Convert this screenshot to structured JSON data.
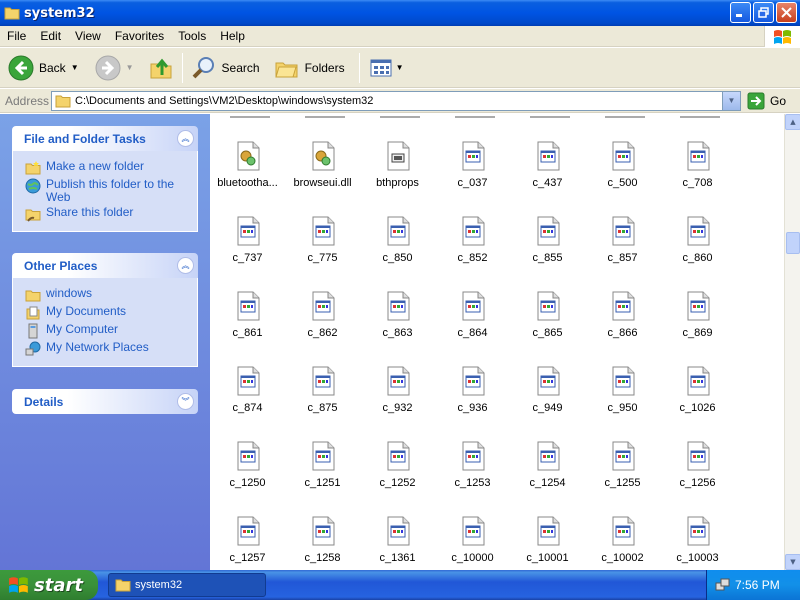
{
  "window": {
    "title": "system32"
  },
  "menu": [
    "File",
    "Edit",
    "View",
    "Favorites",
    "Tools",
    "Help"
  ],
  "toolbar": {
    "back_label": "Back",
    "search_label": "Search",
    "folders_label": "Folders"
  },
  "address": {
    "label": "Address",
    "path": "C:\\Documents and Settings\\VM2\\Desktop\\windows\\system32",
    "go_label": "Go"
  },
  "taskpane": {
    "file_tasks": {
      "title": "File and Folder Tasks",
      "items": [
        {
          "label": "Make a new folder",
          "icon": "new-folder-icon"
        },
        {
          "label": "Publish this folder to the Web",
          "icon": "publish-web-icon"
        },
        {
          "label": "Share this folder",
          "icon": "share-folder-icon"
        }
      ]
    },
    "other_places": {
      "title": "Other Places",
      "items": [
        {
          "label": "windows",
          "icon": "folder-icon"
        },
        {
          "label": "My Documents",
          "icon": "my-documents-icon"
        },
        {
          "label": "My Computer",
          "icon": "my-computer-icon"
        },
        {
          "label": "My Network Places",
          "icon": "network-places-icon"
        }
      ]
    },
    "details": {
      "title": "Details"
    }
  },
  "files": [
    {
      "name": "bluetootha...",
      "type": "dll"
    },
    {
      "name": "browseui.dll",
      "type": "dll"
    },
    {
      "name": "bthprops",
      "type": "cpl"
    },
    {
      "name": "c_037",
      "type": "nls"
    },
    {
      "name": "c_437",
      "type": "nls"
    },
    {
      "name": "c_500",
      "type": "nls"
    },
    {
      "name": "c_708",
      "type": "nls"
    },
    {
      "name": "c_737",
      "type": "nls"
    },
    {
      "name": "c_775",
      "type": "nls"
    },
    {
      "name": "c_850",
      "type": "nls"
    },
    {
      "name": "c_852",
      "type": "nls"
    },
    {
      "name": "c_855",
      "type": "nls"
    },
    {
      "name": "c_857",
      "type": "nls"
    },
    {
      "name": "c_860",
      "type": "nls"
    },
    {
      "name": "c_861",
      "type": "nls"
    },
    {
      "name": "c_862",
      "type": "nls"
    },
    {
      "name": "c_863",
      "type": "nls"
    },
    {
      "name": "c_864",
      "type": "nls"
    },
    {
      "name": "c_865",
      "type": "nls"
    },
    {
      "name": "c_866",
      "type": "nls"
    },
    {
      "name": "c_869",
      "type": "nls"
    },
    {
      "name": "c_874",
      "type": "nls"
    },
    {
      "name": "c_875",
      "type": "nls"
    },
    {
      "name": "c_932",
      "type": "nls"
    },
    {
      "name": "c_936",
      "type": "nls"
    },
    {
      "name": "c_949",
      "type": "nls"
    },
    {
      "name": "c_950",
      "type": "nls"
    },
    {
      "name": "c_1026",
      "type": "nls"
    },
    {
      "name": "c_1250",
      "type": "nls"
    },
    {
      "name": "c_1251",
      "type": "nls"
    },
    {
      "name": "c_1252",
      "type": "nls"
    },
    {
      "name": "c_1253",
      "type": "nls"
    },
    {
      "name": "c_1254",
      "type": "nls"
    },
    {
      "name": "c_1255",
      "type": "nls"
    },
    {
      "name": "c_1256",
      "type": "nls"
    },
    {
      "name": "c_1257",
      "type": "nls"
    },
    {
      "name": "c_1258",
      "type": "nls"
    },
    {
      "name": "c_1361",
      "type": "nls"
    },
    {
      "name": "c_10000",
      "type": "nls"
    },
    {
      "name": "c_10001",
      "type": "nls"
    },
    {
      "name": "c_10002",
      "type": "nls"
    },
    {
      "name": "c_10003",
      "type": "nls"
    }
  ],
  "taskbar": {
    "start_label": "start",
    "task_label": "system32",
    "clock": "7:56 PM"
  }
}
